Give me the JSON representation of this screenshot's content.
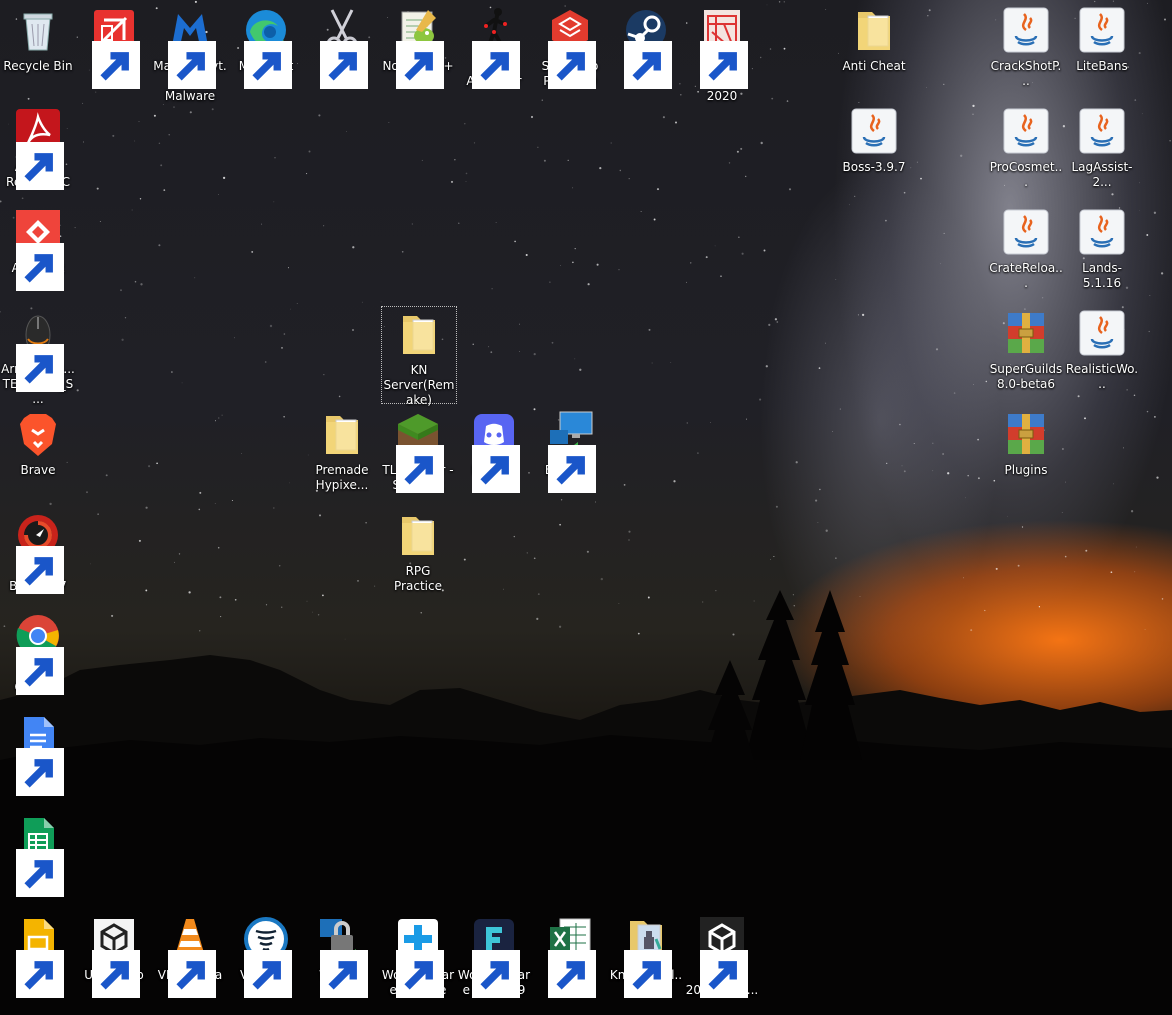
{
  "desktop": {
    "icons": [
      {
        "id": "recycle-bin",
        "label": "Recycle Bin",
        "icon": "recycle-bin-icon",
        "shortcut": false
      },
      {
        "id": "layout-2020",
        "label": "LayOut 2020",
        "icon": "layout-icon",
        "shortcut": true
      },
      {
        "id": "malwarebytes",
        "label": "Malwarebyt... Anti-Malware",
        "icon": "malwarebytes-icon",
        "shortcut": true
      },
      {
        "id": "microsoft-edge",
        "label": "Microsoft Edge",
        "icon": "edge-icon",
        "shortcut": true
      },
      {
        "id": "netcut",
        "label": "netcut",
        "icon": "scissors-icon",
        "shortcut": true
      },
      {
        "id": "notepad-plus-plus",
        "label": "Notepad++",
        "icon": "notepad-plus-plus-icon",
        "shortcut": true
      },
      {
        "id": "pivot-animator",
        "label": "Pivot Animator",
        "icon": "stick-figure-icon",
        "shortcut": true
      },
      {
        "id": "sketchup-pro-2020",
        "label": "SketchUp Pro 2020",
        "icon": "sketchup-icon",
        "shortcut": true
      },
      {
        "id": "steam",
        "label": "Steam",
        "icon": "steam-icon",
        "shortcut": true
      },
      {
        "id": "style-builder-2020",
        "label": "Style Builder 2020",
        "icon": "style-builder-icon",
        "shortcut": true
      },
      {
        "id": "anti-cheat",
        "label": "Anti Cheat",
        "icon": "folder-icon",
        "shortcut": false
      },
      {
        "id": "crackshot",
        "label": "CrackShotP...",
        "icon": "java-icon",
        "shortcut": false
      },
      {
        "id": "litebans",
        "label": "LiteBans",
        "icon": "java-icon",
        "shortcut": false
      },
      {
        "id": "acrobat-reader",
        "label": "Acrobat Reader DC",
        "icon": "acrobat-icon",
        "shortcut": true
      },
      {
        "id": "boss",
        "label": "Boss-3.9.7",
        "icon": "java-icon",
        "shortcut": false
      },
      {
        "id": "procosmetics",
        "label": "ProCosmet...",
        "icon": "java-icon",
        "shortcut": false
      },
      {
        "id": "lagassist",
        "label": "LagAssist-2...",
        "icon": "java-icon",
        "shortcut": false
      },
      {
        "id": "anydesk",
        "label": "AnyDesk",
        "icon": "anydesk-icon",
        "shortcut": true
      },
      {
        "id": "cratereloaded",
        "label": "CrateReloa...",
        "icon": "java-icon",
        "shortcut": false
      },
      {
        "id": "lands",
        "label": "Lands-5.1.16",
        "icon": "java-icon",
        "shortcut": false
      },
      {
        "id": "armaggeddon",
        "label": "Armagged... TEXTRON_S...",
        "icon": "mouse-icon",
        "shortcut": true
      },
      {
        "id": "kn-server",
        "label": "KN Server(Remake)",
        "icon": "folder-icon",
        "shortcut": false,
        "selected": true
      },
      {
        "id": "superguilds",
        "label": "SuperGuilds 8.0-beta6",
        "icon": "winrar-icon",
        "shortcut": false
      },
      {
        "id": "realisticworld",
        "label": "RealisticWo...",
        "icon": "java-icon",
        "shortcut": false
      },
      {
        "id": "brave",
        "label": "Brave",
        "icon": "brave-lion-icon",
        "shortcut": false
      },
      {
        "id": "premade-hypixel",
        "label": "Premade Hypixe...",
        "icon": "folder-icon",
        "shortcut": false
      },
      {
        "id": "tlauncher",
        "label": "TLauncher - Shortcut",
        "icon": "grass-block-icon",
        "shortcut": true
      },
      {
        "id": "discord",
        "label": "Discord",
        "icon": "discord-icon",
        "shortcut": true
      },
      {
        "id": "extravm",
        "label": "ExtraVM",
        "icon": "remote-desktop-icon",
        "shortcut": true
      },
      {
        "id": "plugins",
        "label": "Plugins",
        "icon": "winrar-icon",
        "shortcut": false
      },
      {
        "id": "driver-booster",
        "label": "Driver Booster 7",
        "icon": "driver-booster-icon",
        "shortcut": true
      },
      {
        "id": "rpg-practice",
        "label": "RPG Practice",
        "icon": "folder-icon",
        "shortcut": false
      },
      {
        "id": "google-chrome",
        "label": "Google Chrome",
        "icon": "chrome-icon",
        "shortcut": true
      },
      {
        "id": "google-docs",
        "label": "Google Docs",
        "icon": "google-docs-icon",
        "shortcut": true
      },
      {
        "id": "google-sheets",
        "label": "Google Sheets",
        "icon": "google-sheets-icon",
        "shortcut": true
      },
      {
        "id": "google-slides",
        "label": "Google Slides",
        "icon": "google-slides-icon",
        "shortcut": true
      },
      {
        "id": "unity-hub",
        "label": "Unity Hub",
        "icon": "unity-hub-icon",
        "shortcut": true
      },
      {
        "id": "vlc",
        "label": "VLC media player",
        "icon": "vlc-cone-icon",
        "shortcut": true
      },
      {
        "id": "vyprvpn",
        "label": "VyprVPN",
        "icon": "vyprvpn-icon",
        "shortcut": true
      },
      {
        "id": "winscp",
        "label": "WinSCP",
        "icon": "winscp-lock-icon",
        "shortcut": true
      },
      {
        "id": "wondershare-drfone",
        "label": "Wondershare Dr.Fone",
        "icon": "drfone-icon",
        "shortcut": true
      },
      {
        "id": "wondershare-filmora",
        "label": "Wondershare Filmora9",
        "icon": "filmora-icon",
        "shortcut": true
      },
      {
        "id": "daves-mc",
        "label": "Daves-MC-...",
        "icon": "excel-icon",
        "shortcut": true
      },
      {
        "id": "knightreal",
        "label": "KnightReal...",
        "icon": "knight-image-icon",
        "shortcut": true
      },
      {
        "id": "unity-2019",
        "label": "Unity 2019.4.13...",
        "icon": "unity-icon",
        "shortcut": true
      }
    ]
  }
}
